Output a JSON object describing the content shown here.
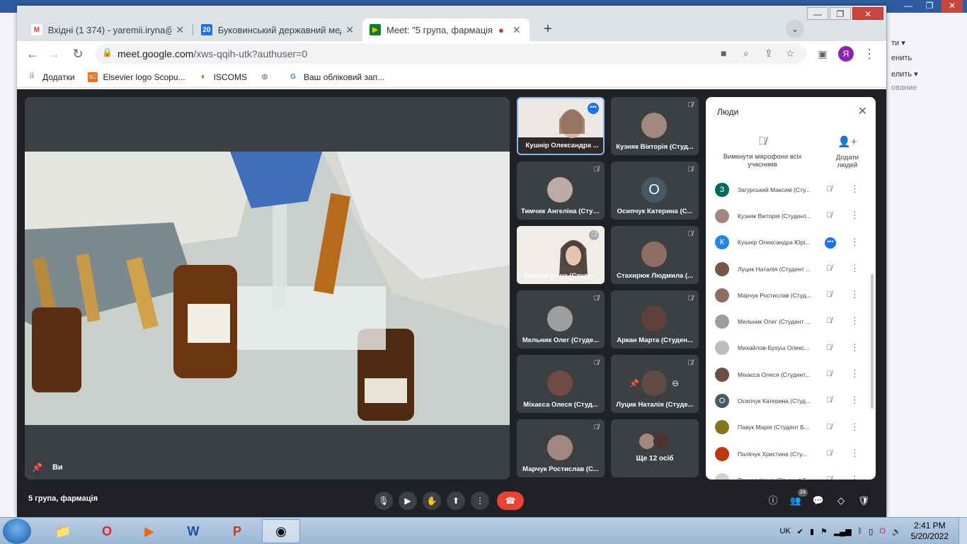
{
  "browser": {
    "tabs": [
      {
        "title": "Вхідні (1 374) - yaremii.iryna@bs",
        "favicon": "M",
        "color": "#ea4335"
      },
      {
        "title": "Буковинський державний меди",
        "favicon": "20",
        "color": "#1a73e8"
      },
      {
        "title": "Meet: \"5 група, фармація\"",
        "favicon": "meet-icon",
        "color": "#00832d",
        "recording": "●"
      }
    ],
    "url_host": "meet.google.com",
    "url_path": "/xws-qqih-utk?authuser=0",
    "profile_letter": "Я",
    "bookmarks": [
      {
        "label": "Додатки",
        "icon": "apps-grid-icon"
      },
      {
        "label": "Elsevier logo Scopu...",
        "icon": "SC"
      },
      {
        "label": "ISCOMS",
        "icon": "iscoms-icon"
      },
      {
        "label": "",
        "icon": "globe-icon"
      },
      {
        "label": "Ваш обліковий зап...",
        "icon": "google-icon"
      }
    ]
  },
  "meet": {
    "self_label": "Ви",
    "meeting_name": "5 група, фармація",
    "tiles": [
      {
        "name": "Кушнір Олександра ...",
        "type": "camera",
        "speaking": true
      },
      {
        "name": "Кузняк Вікторія (Студ...",
        "type": "avatar",
        "color": "#a1887f"
      },
      {
        "name": "Тимчик Ангеліна (Студ...",
        "type": "avatar",
        "color": "#bcaaa4"
      },
      {
        "name": "Осипчук Катерина (С...",
        "type": "letter",
        "letter": "О"
      },
      {
        "name": "Паскар Ірина (Студе...",
        "type": "camera"
      },
      {
        "name": "Стахирюк Людмила (...",
        "type": "avatar",
        "color": "#8d6e63"
      },
      {
        "name": "Мельник Олег (Студе...",
        "type": "avatar",
        "color": "#9e9e9e"
      },
      {
        "name": "Аркан Марта (Студен...",
        "type": "avatar",
        "color": "#5d4037"
      },
      {
        "name": "Міхаєса Олеся (Студ...",
        "type": "avatar",
        "color": "#6d4c41"
      },
      {
        "name": "Луцик Наталія (Студе...",
        "type": "avatar",
        "color": "#795548"
      },
      {
        "name": "Марчук Ростислав (С...",
        "type": "avatar",
        "color": "#a1887f"
      },
      {
        "name": "Ще 12 осіб",
        "type": "more"
      }
    ],
    "people": {
      "title": "Люди",
      "mute_all": "Вимкнути мікрофони всіх учасників",
      "add": "Додати людей",
      "count": "24",
      "list": [
        {
          "name": "Загурський Максим (Сту...",
          "letter": "З",
          "color": "#00695c"
        },
        {
          "name": "Кузняк Вікторія (Студент...",
          "letter": "",
          "color": "#a1887f"
        },
        {
          "name": "Кушнір Олександра Юрі...",
          "letter": "К",
          "color": "#1e88e5",
          "active": true
        },
        {
          "name": "Луцик Наталія (Студент ...",
          "letter": "",
          "color": "#795548"
        },
        {
          "name": "Марчук Ростислав (Студ...",
          "letter": "",
          "color": "#8d6e63"
        },
        {
          "name": "Мельник Олег (Студент ...",
          "letter": "",
          "color": "#9e9e9e"
        },
        {
          "name": "Михайлов-Бухуш Олекс...",
          "letter": "",
          "color": "#bdbdbd"
        },
        {
          "name": "Міхаєса Олеся (Студент...",
          "letter": "",
          "color": "#6d4c41"
        },
        {
          "name": "Осипчук Катерина (Студ...",
          "letter": "О",
          "color": "#455a64"
        },
        {
          "name": "Павук Марія (Студент Б...",
          "letter": "",
          "color": "#827717"
        },
        {
          "name": "Паліічук Христина (Сту...",
          "letter": "",
          "color": "#bf360c"
        },
        {
          "name": "Паскар Ірина (Студент Б...",
          "letter": "",
          "color": "#d7ccc8"
        }
      ]
    }
  },
  "word_bg": {
    "lines": [
      "ти ▾",
      "енить",
      "елить ▾",
      "ование"
    ]
  },
  "taskbar": {
    "lang": "UK",
    "time": "2:41 PM",
    "date": "5/20/2022"
  }
}
